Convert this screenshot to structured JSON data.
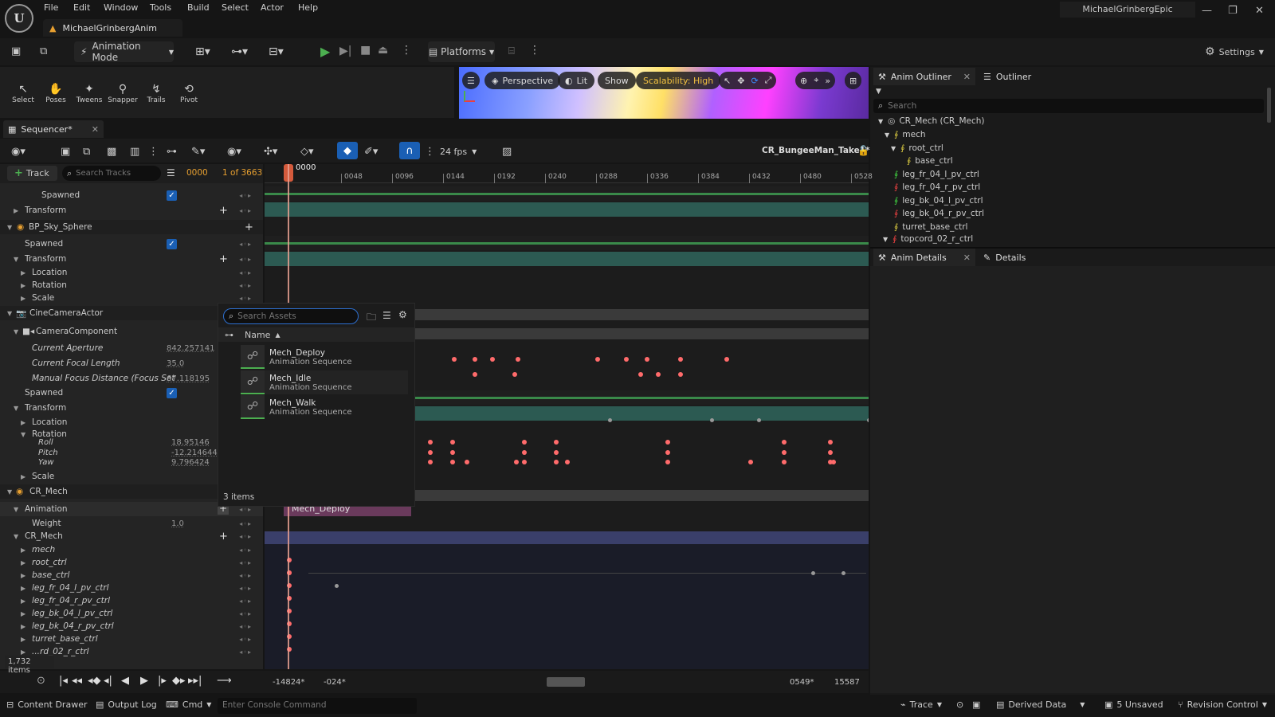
{
  "menu": [
    "File",
    "Edit",
    "Window",
    "Tools",
    "Build",
    "Select",
    "Actor",
    "Help"
  ],
  "project_tab": "MichaelGrinbergAnim",
  "user": "MichaelGrinbergEpic",
  "toolbar": {
    "mode": "Animation Mode",
    "platforms": "Platforms",
    "settings": "Settings"
  },
  "modes": [
    "Select",
    "Poses",
    "Tweens",
    "Snapper",
    "Trails",
    "Pivot"
  ],
  "viewport": {
    "perspective": "Perspective",
    "lit": "Lit",
    "show": "Show",
    "scalability": "Scalability: High"
  },
  "sequencer": {
    "tab": "Sequencer*",
    "fps": "24 fps",
    "sequence_name": "CR_BungeeMan_Take1*",
    "track_button": "Track",
    "search_placeholder": "Search Tracks",
    "frame": "0000",
    "frame_count": "1 of 3663",
    "playhead_label": "0000",
    "ruler_ticks": [
      "0048",
      "0096",
      "0144",
      "0192",
      "0240",
      "0288",
      "0336",
      "0384",
      "0432",
      "0480",
      "0528"
    ],
    "items_count": "1,732 items",
    "range_start": "-14824*",
    "range_start2": "-024*",
    "range_end": "0549*",
    "range_end2": "15587"
  },
  "tracks": {
    "spawned1": "Spawned",
    "transform1": "Transform",
    "sky": "BP_Sky_Sphere",
    "spawned2": "Spawned",
    "transform2": "Transform",
    "location1": "Location",
    "rotation1": "Rotation",
    "scale1": "Scale",
    "camera_actor": "CineCameraActor",
    "camera_component": "CameraComponent",
    "aperture_label": "Current Aperture",
    "aperture_value": "842.257141",
    "focal_label": "Current Focal Length",
    "focal_value": "35.0",
    "focus_label": "Manual Focus Distance (Focus Set",
    "focus_value": "67.118195",
    "spawned3": "Spawned",
    "transform3": "Transform",
    "location2": "Location",
    "rotation2": "Rotation",
    "roll_label": "Roll",
    "roll_value": "18.95146",
    "pitch_label": "Pitch",
    "pitch_value": "-12.214644",
    "yaw_label": "Yaw",
    "yaw_value": "9.796424",
    "scale2": "Scale",
    "cr_mech": "CR_Mech",
    "animation": "Animation",
    "weight_label": "Weight",
    "weight_value": "1.0",
    "cr_mech2": "CR_Mech",
    "controls": [
      "mech",
      "root_ctrl",
      "base_ctrl",
      "leg_fr_04_l_pv_ctrl",
      "leg_fr_04_r_pv_ctrl",
      "leg_bk_04_l_pv_ctrl",
      "leg_bk_04_r_pv_ctrl",
      "turret_base_ctrl",
      "...rd_02_r_ctrl"
    ],
    "anim_section": "Mech_Deploy"
  },
  "asset_picker": {
    "search_placeholder": "Search Assets",
    "column": "Name",
    "assets": [
      {
        "name": "Mech_Deploy",
        "type": "Animation Sequence"
      },
      {
        "name": "Mech_Idle",
        "type": "Animation Sequence"
      },
      {
        "name": "Mech_Walk",
        "type": "Animation Sequence"
      }
    ],
    "count": "3 items"
  },
  "anim_outliner": {
    "tab": "Anim Outliner",
    "tab2": "Outliner",
    "search_placeholder": "Search",
    "items": [
      "CR_Mech  (CR_Mech)",
      "mech",
      "root_ctrl",
      "base_ctrl",
      "leg_fr_04_l_pv_ctrl",
      "leg_fr_04_r_pv_ctrl",
      "leg_bk_04_l_pv_ctrl",
      "leg_bk_04_r_pv_ctrl",
      "turret_base_ctrl",
      "topcord_02_r_ctrl"
    ]
  },
  "anim_details": {
    "tab": "Anim Details",
    "tab2": "Details"
  },
  "statusbar": {
    "content_drawer": "Content Drawer",
    "output_log": "Output Log",
    "cmd": "Cmd",
    "console_placeholder": "Enter Console Command",
    "trace": "Trace",
    "derived": "Derived Data",
    "unsaved": "5 Unsaved",
    "revision": "Revision Control"
  },
  "colors": {
    "accent": "#1a5fb4",
    "key": "#ff6b6b",
    "playhead": "#d45a3c",
    "anim_section": "#6a3a5c"
  }
}
